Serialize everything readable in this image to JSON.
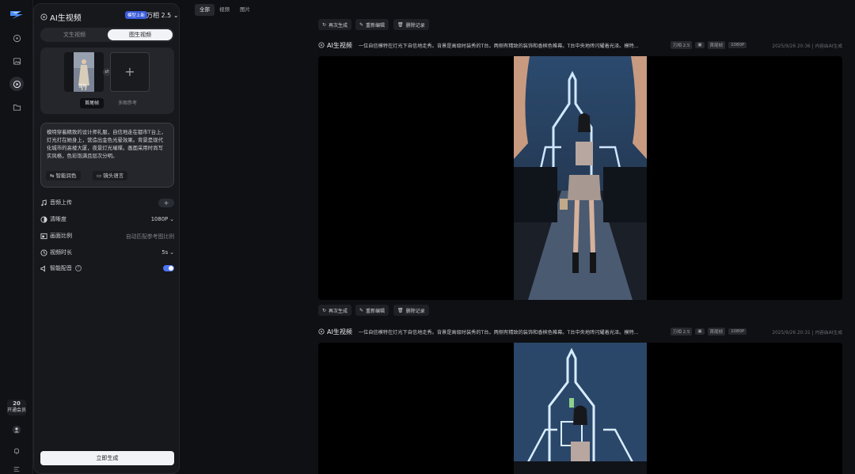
{
  "sidebar": {
    "vip_count": "20",
    "vip_label": "开通会员"
  },
  "panel": {
    "title": "AI生视频",
    "badge": "模型上新",
    "model": "万相 2.5",
    "modes": [
      "文生视频",
      "图生视频"
    ],
    "active_mode": 1,
    "frames": {
      "thumb_label": "首帧",
      "tabs": [
        "首尾帧",
        "多图参考"
      ],
      "active_tab": 0
    },
    "prompt_text": "模特穿着精致的设计师礼服，自信地走在都市T台上，灯光打在她身上，营造出金色光晕效果。背景是现代化城市的高楼大厦，夜景灯光璀璨。画面采用时尚写实风格，色彩饱满且层次分明。",
    "prompt_chips": [
      "智能润色",
      "镜头语言"
    ],
    "settings": [
      {
        "label": "音频上传",
        "value": "+"
      },
      {
        "label": "清晰度",
        "value": "1080P"
      },
      {
        "label": "画面比例",
        "value": "自动匹配参考图比例"
      },
      {
        "label": "视频时长",
        "value": "5s"
      },
      {
        "label": "智能配音",
        "value": ""
      }
    ],
    "generate_label": "立即生成"
  },
  "top_tabs": [
    "全部",
    "视频",
    "图片"
  ],
  "actions": {
    "regenerate": "再次生成",
    "reedit": "重新编辑",
    "delete": "删除记录"
  },
  "items": [
    {
      "title": "AI生视频",
      "prompt": "一位自信模特在灯光下自信地走秀。背景是高级时装秀的T台。两侧有精致的装饰和香槟色帷幕。T台中央地砖闪耀着光泽。模特...",
      "tags": [
        "万相 2.5",
        "首尾帧",
        "1080P"
      ],
      "meta": "2025/9/26 20:36 | 内容由AI生成"
    },
    {
      "title": "AI生视频",
      "prompt": "一位自信模特在灯光下自信地走秀。背景是高级时装秀的T台。两侧有精致的装饰和香槟色帷幕。T台中央地砖闪耀着光泽。模特...",
      "tags": [
        "万相 2.5",
        "首尾帧",
        "1080P"
      ],
      "meta": "2025/9/26 20:31 | 内容由AI生成"
    }
  ],
  "colors": {
    "accent": "#4d74f2",
    "background": "#0f1013",
    "panel": "#17181c"
  }
}
